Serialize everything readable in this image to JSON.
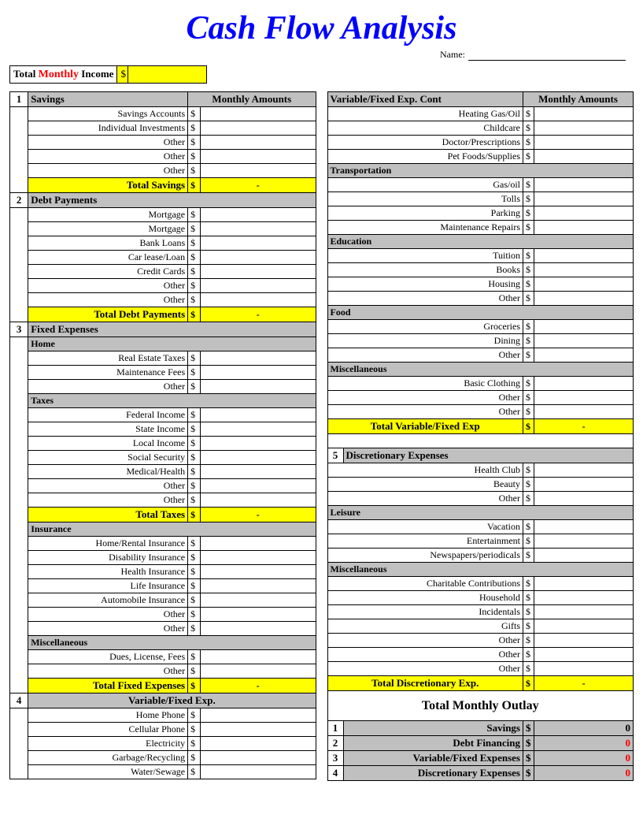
{
  "title": "Cash Flow Analysis",
  "name_label": "Name:",
  "income": {
    "label_pre": "Total",
    "label_mon": "Monthly",
    "label_post": "Income",
    "dollar": "$"
  },
  "headers": {
    "monthly_amounts": "Monthly Amounts"
  },
  "left": {
    "sec1": {
      "num": "1",
      "title": "Savings",
      "items": [
        "Savings Accounts",
        "Individual Investments",
        "Other",
        "Other",
        "Other"
      ],
      "total_label": "Total Savings",
      "total_val": "-"
    },
    "sec2": {
      "num": "2",
      "title": "Debt Payments",
      "items": [
        "Mortgage",
        "Mortgage",
        "Bank Loans",
        "Car lease/Loan",
        "Credit Cards",
        "Other",
        "Other"
      ],
      "total_label": "Total Debt Payments",
      "total_val": "-"
    },
    "sec3": {
      "num": "3",
      "title": "Fixed Expenses",
      "sub_home": "Home",
      "home_items": [
        "Real Estate Taxes",
        "Maintenance Fees",
        "Other"
      ],
      "sub_taxes": "Taxes",
      "tax_items": [
        "Federal Income",
        "State Income",
        "Local Income",
        "Social Security",
        "Medical/Health",
        "Other",
        "Other"
      ],
      "tax_total_label": "Total Taxes",
      "tax_total_val": "-",
      "sub_ins": "Insurance",
      "ins_items": [
        "Home/Rental Insurance",
        "Disability Insurance",
        "Health Insurance",
        "Life Insurance",
        "Automobile Insurance",
        "Other",
        "Other"
      ],
      "sub_misc": "Miscellaneous",
      "misc_items": [
        "Dues, License, Fees",
        "Other"
      ],
      "total_label": "Total Fixed Expenses",
      "total_val": "-"
    },
    "sec4": {
      "num": "4",
      "title": "Variable/Fixed Exp.",
      "items": [
        "Home Phone",
        "Cellular Phone",
        "Electricity",
        "Garbage/Recycling",
        "Water/Sewage"
      ]
    }
  },
  "right": {
    "sec_cont": {
      "title": "Variable/Fixed Exp. Cont",
      "items": [
        "Heating Gas/Oil",
        "Childcare",
        "Doctor/Prescriptions",
        "Pet Foods/Supplies"
      ],
      "sub_trans": "Transportation",
      "trans_items": [
        "Gas/oil",
        "Tolls",
        "Parking",
        "Maintenance Repairs"
      ],
      "sub_edu": "Education",
      "edu_items": [
        "Tuition",
        "Books",
        "Housing",
        "Other"
      ],
      "sub_food": "Food",
      "food_items": [
        "Groceries",
        "Dining",
        "Other"
      ],
      "sub_misc": "Miscellaneous",
      "misc_items": [
        "Basic Clothing",
        "Other",
        "Other"
      ],
      "total_label": "Total Variable/Fixed Exp",
      "total_val": "-"
    },
    "sec5": {
      "num": "5",
      "title": "Discretionary Expenses",
      "items": [
        "Health Club",
        "Beauty",
        "Other"
      ],
      "sub_leisure": "Leisure",
      "leisure_items": [
        "Vacation",
        "Entertainment",
        "Newspapers/periodicals"
      ],
      "sub_misc": "Miscellaneous",
      "misc_items": [
        "Charitable Contributions",
        "Household",
        "Incidentals",
        "Gifts",
        "Other",
        "Other",
        "Other"
      ],
      "total_label": "Total Discretionary Exp.",
      "total_val": "-"
    },
    "outlay": {
      "title": "Total Monthly Outlay",
      "rows": [
        {
          "n": "1",
          "label": "Savings",
          "val": "0"
        },
        {
          "n": "2",
          "label": "Debt Financing",
          "val": "0"
        },
        {
          "n": "3",
          "label": "Variable/Fixed Expenses",
          "val": "0"
        },
        {
          "n": "4",
          "label": "Discretionary Expenses",
          "val": "0"
        }
      ]
    }
  },
  "dollar": "$"
}
